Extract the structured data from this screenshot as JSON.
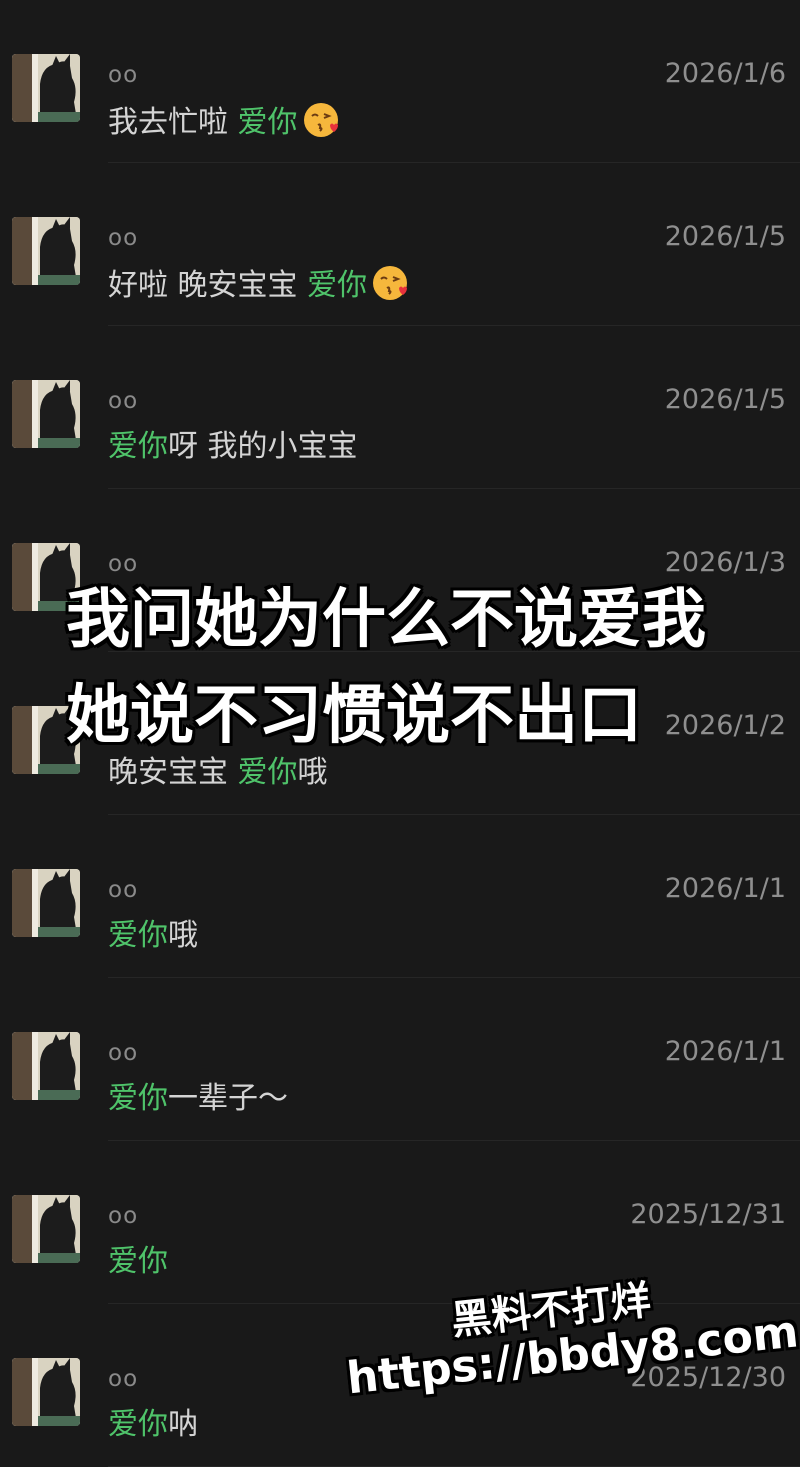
{
  "messages": [
    {
      "name": "oo",
      "time": "2026/1/6",
      "pre": "我去忙啦 ",
      "green": "爱你",
      "post": "",
      "emoji": "kissing-heart-emoji"
    },
    {
      "name": "oo",
      "time": "2026/1/5",
      "pre": "好啦 晚安宝宝 ",
      "green": "爱你",
      "post": "",
      "emoji": "kissing-heart-emoji"
    },
    {
      "name": "oo",
      "time": "2026/1/5",
      "pre": "",
      "green": "爱你",
      "post": "呀 我的小宝宝",
      "emoji": ""
    },
    {
      "name": "oo",
      "time": "2026/1/3",
      "pre": "",
      "green": "",
      "post": "",
      "emoji": ""
    },
    {
      "name": "",
      "time": "2026/1/2",
      "pre": "晚安宝宝 ",
      "green": "爱你",
      "post": "哦",
      "emoji": ""
    },
    {
      "name": "oo",
      "time": "2026/1/1",
      "pre": "",
      "green": "爱你",
      "post": "哦",
      "emoji": ""
    },
    {
      "name": "oo",
      "time": "2026/1/1",
      "pre": "",
      "green": "爱你",
      "post": "一辈子～",
      "emoji": ""
    },
    {
      "name": "oo",
      "time": "2025/12/31",
      "pre": "",
      "green": "爱你",
      "post": "",
      "emoji": ""
    },
    {
      "name": "oo",
      "time": "2025/12/30",
      "pre": "",
      "green": "爱你",
      "post": "呐",
      "emoji": ""
    }
  ],
  "overlay": {
    "caption": "我问她为什么不说爱我 她说不习惯说不出口"
  },
  "watermark": {
    "line1": "黑料不打烊",
    "line2": "https://bbdy8.com"
  },
  "colors": {
    "background": "#191919",
    "love_text": "#4fc36a",
    "message_text": "#d4d4d4",
    "meta_text": "#8f8f8f"
  }
}
